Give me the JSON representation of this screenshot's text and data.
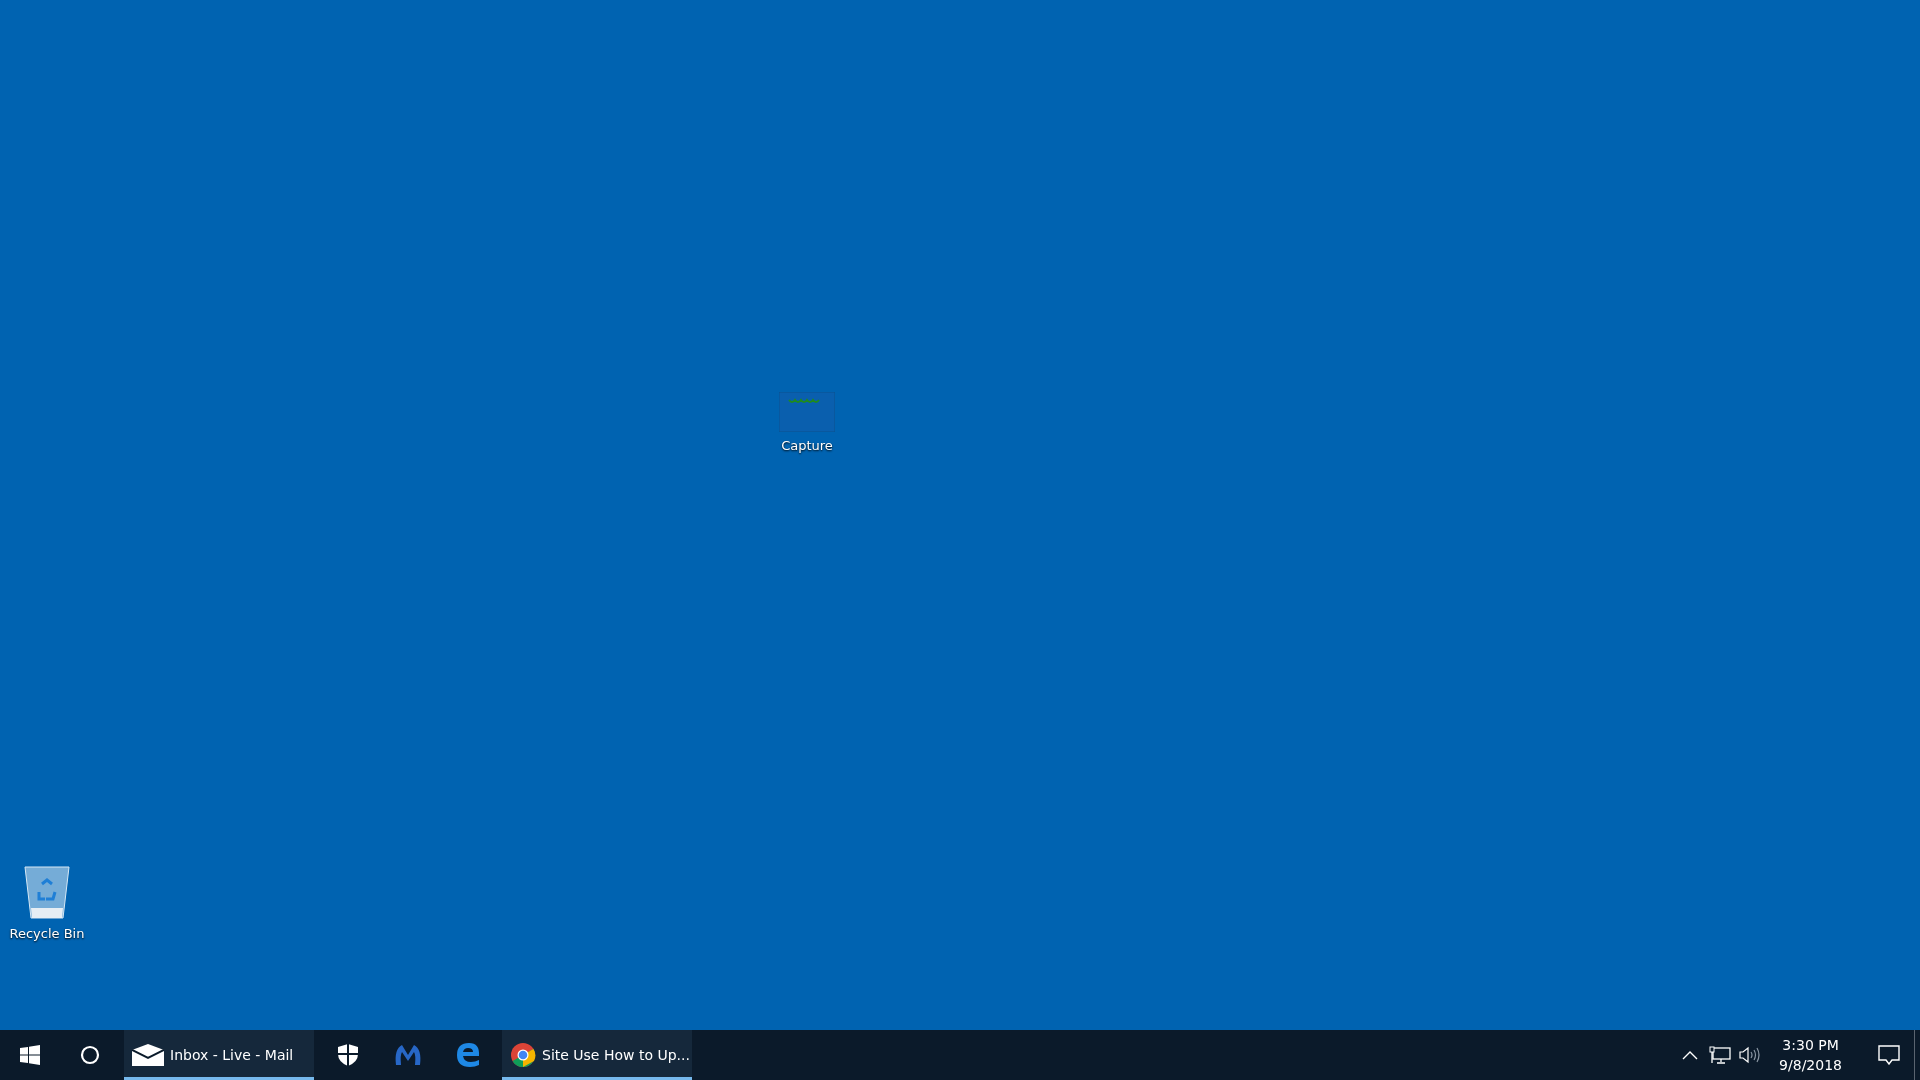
{
  "desktop_icons": [
    {
      "kind": "capture",
      "label": "Capture"
    },
    {
      "kind": "recycle",
      "label": "Recycle Bin"
    }
  ],
  "taskbar": {
    "items": [
      {
        "kind": "mail",
        "label": "Inbox - Live - Mail",
        "running": true
      },
      {
        "kind": "shield",
        "running": false
      },
      {
        "kind": "malware",
        "running": false
      },
      {
        "kind": "edge",
        "running": false
      },
      {
        "kind": "chrome",
        "label": "Site Use How to Up...",
        "running": true
      }
    ],
    "clock": {
      "time": "3:30 PM",
      "date": "9/8/2018"
    }
  }
}
